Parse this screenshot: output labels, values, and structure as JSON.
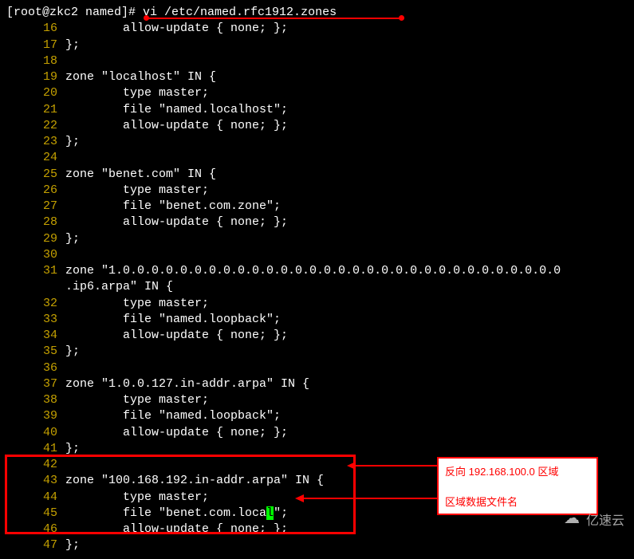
{
  "prompt": "[root@zkc2 named]# ",
  "command": "vi /etc/named.rfc1912.zones",
  "lines": [
    {
      "n": "16",
      "indent": 2,
      "text": "allow-update { none; };"
    },
    {
      "n": "17",
      "indent": 0,
      "text": "};"
    },
    {
      "n": "18",
      "indent": 0,
      "text": ""
    },
    {
      "n": "19",
      "indent": 0,
      "text": "zone \"localhost\" IN {"
    },
    {
      "n": "20",
      "indent": 2,
      "text": "type master;"
    },
    {
      "n": "21",
      "indent": 2,
      "text": "file \"named.localhost\";"
    },
    {
      "n": "22",
      "indent": 2,
      "text": "allow-update { none; };"
    },
    {
      "n": "23",
      "indent": 0,
      "text": "};"
    },
    {
      "n": "24",
      "indent": 0,
      "text": ""
    },
    {
      "n": "25",
      "indent": 0,
      "text": "zone \"benet.com\" IN {"
    },
    {
      "n": "26",
      "indent": 2,
      "text": "type master;"
    },
    {
      "n": "27",
      "indent": 2,
      "text": "file \"benet.com.zone\";"
    },
    {
      "n": "28",
      "indent": 2,
      "text": "allow-update { none; };"
    },
    {
      "n": "29",
      "indent": 0,
      "text": "};"
    },
    {
      "n": "30",
      "indent": 0,
      "text": ""
    },
    {
      "n": "31",
      "indent": 0,
      "text": "zone \"1.0.0.0.0.0.0.0.0.0.0.0.0.0.0.0.0.0.0.0.0.0.0.0.0.0.0.0.0.0.0.0",
      "wrap": ".ip6.arpa\" IN {"
    },
    {
      "n": "32",
      "indent": 2,
      "text": "type master;"
    },
    {
      "n": "33",
      "indent": 2,
      "text": "file \"named.loopback\";"
    },
    {
      "n": "34",
      "indent": 2,
      "text": "allow-update { none; };"
    },
    {
      "n": "35",
      "indent": 0,
      "text": "};"
    },
    {
      "n": "36",
      "indent": 0,
      "text": ""
    },
    {
      "n": "37",
      "indent": 0,
      "text": "zone \"1.0.0.127.in-addr.arpa\" IN {"
    },
    {
      "n": "38",
      "indent": 2,
      "text": "type master;"
    },
    {
      "n": "39",
      "indent": 2,
      "text": "file \"named.loopback\";"
    },
    {
      "n": "40",
      "indent": 2,
      "text": "allow-update { none; };"
    },
    {
      "n": "41",
      "indent": 0,
      "text": "};"
    },
    {
      "n": "42",
      "indent": 0,
      "text": ""
    },
    {
      "n": "43",
      "indent": 0,
      "text": "zone \"100.168.192.in-addr.arpa\" IN {"
    },
    {
      "n": "44",
      "indent": 2,
      "text": "type master;"
    },
    {
      "n": "45",
      "indent": 2,
      "cursor": true,
      "pre": "file \"benet.com.loca",
      "cur": "l",
      "post": "\";"
    },
    {
      "n": "46",
      "indent": 2,
      "text": "allow-update { none; };"
    },
    {
      "n": "47",
      "indent": 0,
      "text": "};"
    }
  ],
  "annotation": {
    "line1": "反向 192.168.100.0 区域",
    "line2": "区域数据文件名"
  },
  "watermark": "亿速云"
}
